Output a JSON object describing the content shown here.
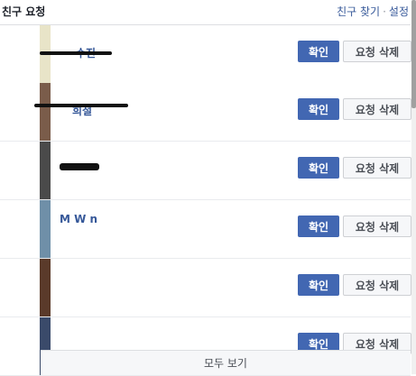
{
  "header": {
    "title": "친구 요청",
    "find_friends": "친구 찾기",
    "separator": "·",
    "settings": "설정"
  },
  "requests": [
    {
      "name": "수진",
      "confirm": "확인",
      "delete": "요청 삭제",
      "avatar_color": "#e8e4c8"
    },
    {
      "name": "희철",
      "confirm": "확인",
      "delete": "요청 삭제",
      "avatar_color": "#7a5c4a"
    },
    {
      "name": "",
      "confirm": "확인",
      "delete": "요청 삭제",
      "avatar_color": "#4a4a4a"
    },
    {
      "name": "M     W n",
      "confirm": "확인",
      "delete": "요청 삭제",
      "avatar_color": "#6f8fa8"
    },
    {
      "name": "",
      "confirm": "확인",
      "delete": "요청 삭제",
      "avatar_color": "#5a3a2a"
    },
    {
      "name": "",
      "confirm": "확인",
      "delete": "요청 삭제",
      "avatar_color": "#3a4a6a"
    }
  ],
  "footer": {
    "see_all": "모두 보기"
  }
}
